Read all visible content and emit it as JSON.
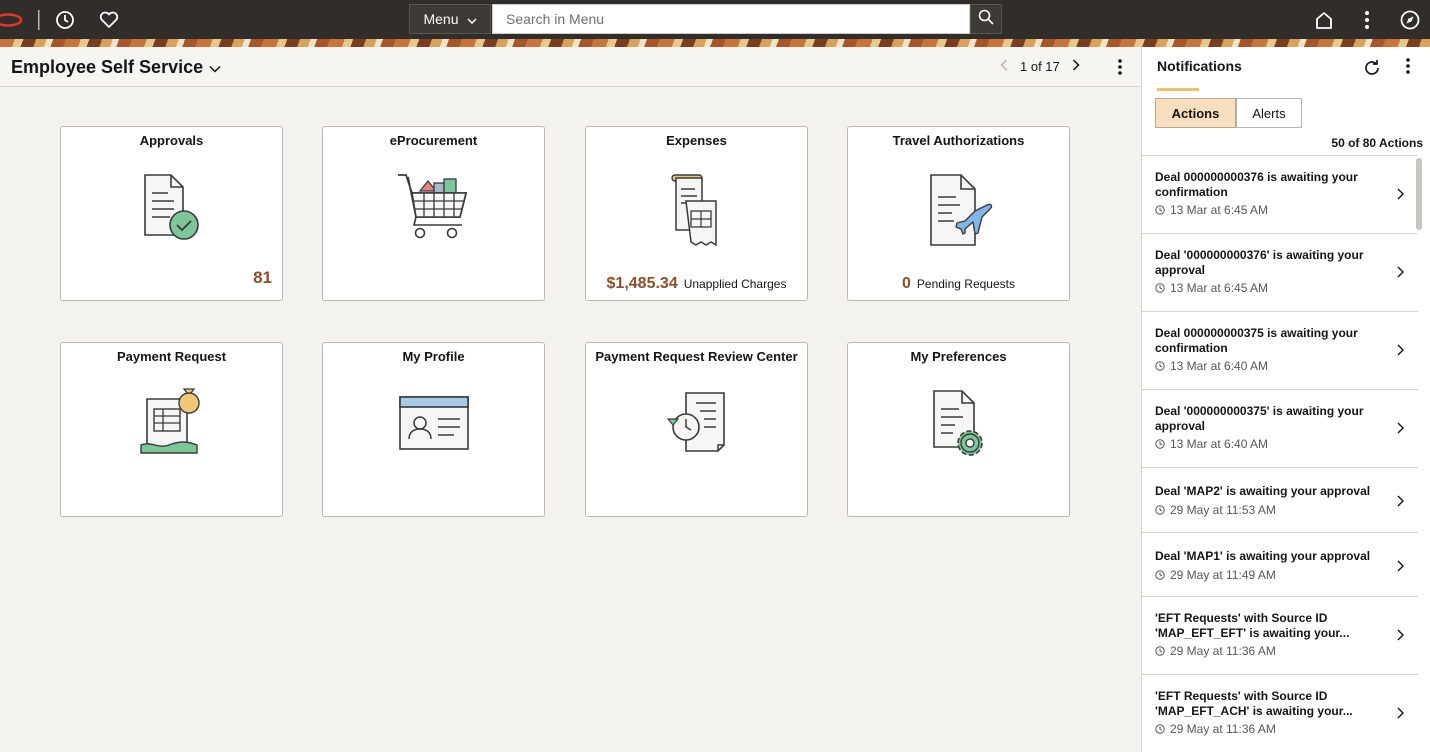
{
  "topbar": {
    "menu_label": "Menu",
    "search_placeholder": "Search in Menu"
  },
  "page": {
    "title": "Employee Self Service",
    "pager": "1 of 17"
  },
  "tiles": [
    {
      "title": "Approvals",
      "count": "81"
    },
    {
      "title": "eProcurement"
    },
    {
      "title": "Expenses",
      "value": "$1,485.34",
      "label": "Unapplied Charges"
    },
    {
      "title": "Travel Authorizations",
      "value": "0",
      "label": "Pending Requests"
    },
    {
      "title": "Payment Request"
    },
    {
      "title": "My Profile"
    },
    {
      "title": "Payment Request Review Center"
    },
    {
      "title": "My Preferences"
    }
  ],
  "notifications": {
    "title": "Notifications",
    "tab_actions": "Actions",
    "tab_alerts": "Alerts",
    "count_label": "50 of 80 Actions",
    "items": [
      {
        "text": "Deal 000000000376 is awaiting your confirmation",
        "time": "13 Mar at 6:45 AM"
      },
      {
        "text": "Deal '000000000376' is awaiting your approval",
        "time": "13 Mar at 6:45 AM"
      },
      {
        "text": "Deal 000000000375 is awaiting your confirmation",
        "time": "13 Mar at 6:40 AM"
      },
      {
        "text": "Deal '000000000375' is awaiting your approval",
        "time": "13 Mar at 6:40 AM"
      },
      {
        "text": "Deal 'MAP2' is awaiting your approval",
        "time": "29 May at 11:53 AM"
      },
      {
        "text": "Deal 'MAP1' is awaiting your approval",
        "time": "29 May at 11:49 AM"
      },
      {
        "text": "'EFT Requests' with Source ID 'MAP_EFT_EFT' is awaiting your...",
        "time": "29 May at 11:36 AM"
      },
      {
        "text": "'EFT Requests' with Source ID 'MAP_EFT_ACH' is awaiting your...",
        "time": "29 May at 11:36 AM"
      }
    ]
  },
  "colors": {
    "accent": "#8a4f2b",
    "topbar": "#312d2a",
    "active_tab": "#f8dfbf"
  }
}
